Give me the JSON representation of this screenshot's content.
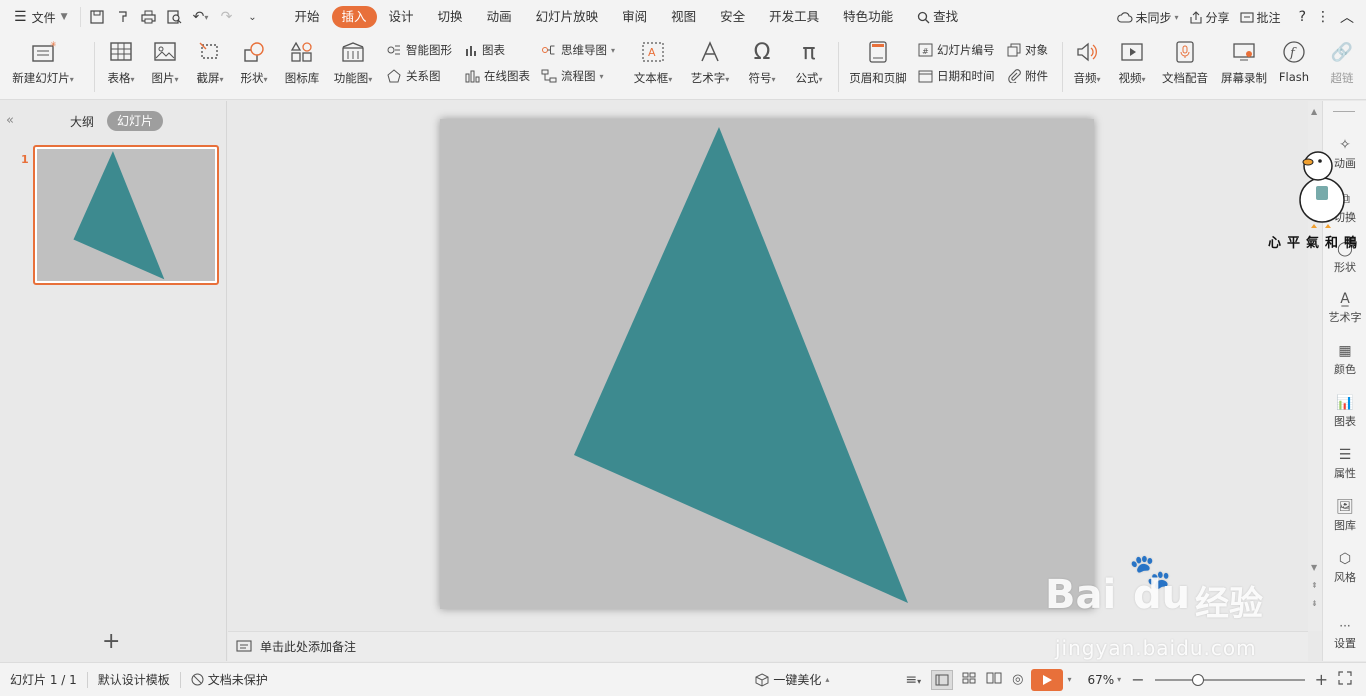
{
  "menubar": {
    "file_label": "文件",
    "menus": [
      "开始",
      "插入",
      "设计",
      "切换",
      "动画",
      "幻灯片放映",
      "审阅",
      "视图",
      "安全",
      "开发工具",
      "特色功能"
    ],
    "active_menu": "插入",
    "search_label": "查找",
    "sync_label": "未同步",
    "share_label": "分享",
    "comment_label": "批注",
    "help_label": "?"
  },
  "toolbar": {
    "new_slide": "新建幻灯片",
    "table": "表格",
    "picture": "图片",
    "screenshot": "截屏",
    "shape": "形状",
    "icon_lib": "图标库",
    "func_chart": "功能图",
    "smart_art": "智能图形",
    "chart": "图表",
    "mind_map": "思维导图",
    "relation": "关系图",
    "online_chart": "在线图表",
    "flowchart": "流程图",
    "textbox": "文本框",
    "wordart": "艺术字",
    "symbol": "符号",
    "formula": "公式",
    "header_footer": "页眉和页脚",
    "slide_number": "幻灯片编号",
    "object": "对象",
    "datetime": "日期和时间",
    "attachment": "附件",
    "audio": "音频",
    "video": "视频",
    "doc_dub": "文档配音",
    "screen_record": "屏幕录制",
    "flash": "Flash",
    "more": "超链"
  },
  "leftpanel": {
    "tab_outline": "大纲",
    "tab_slides": "幻灯片",
    "slide_number": "1",
    "add_label": "+"
  },
  "notes": {
    "placeholder": "单击此处添加备注"
  },
  "sidebar": {
    "items": [
      "动画",
      "切换",
      "形状",
      "艺术字",
      "颜色",
      "图表",
      "属性",
      "图库",
      "风格",
      "设置"
    ]
  },
  "statusbar": {
    "slide_info": "幻灯片 1 / 1",
    "template": "默认设计模板",
    "protect": "文档未保护",
    "beautify": "一键美化",
    "zoom": "67%",
    "zoom_fraction": 0.29
  },
  "watermark": {
    "brand": "Bai",
    "brand2": "du",
    "brand_cn": "经验",
    "url": "jingyan.baidu.com",
    "sticker_text": "心平氣和鴨"
  },
  "colors": {
    "accent": "#e8703a",
    "triangle": "#3d8a8f",
    "slide_bg": "#c0c0c0"
  }
}
